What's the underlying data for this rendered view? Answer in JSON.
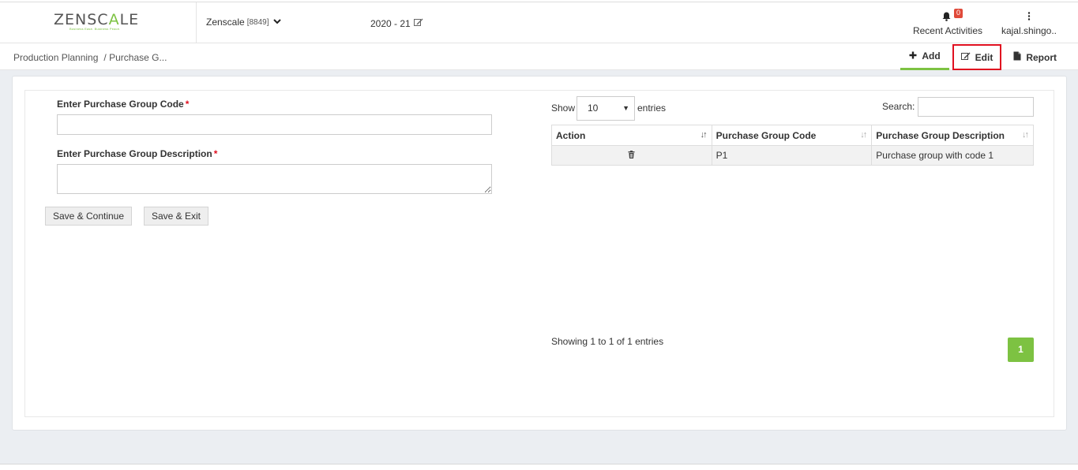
{
  "header": {
    "logo_prefix": "ZENSC",
    "logo_accent": "A",
    "logo_suffix": "LE",
    "logo_tagline": "Business Ease. Business Peace.",
    "company_name": "Zenscale",
    "company_code": "[8849]",
    "financial_year": "2020 - 21",
    "notification_count": "0",
    "notifications_label": "Recent Activities",
    "user_label": "kajal.shingo.."
  },
  "breadcrumb": {
    "root": "Production Planning",
    "current": "/ Purchase G..."
  },
  "toolbar": {
    "add_label": "Add",
    "edit_label": "Edit",
    "report_label": "Report"
  },
  "form": {
    "code_label": "Enter Purchase Group Code",
    "code_value": "",
    "description_label": "Enter Purchase Group Description",
    "description_value": "",
    "required_mark": "*",
    "save_continue_label": "Save & Continue",
    "save_exit_label": "Save & Exit"
  },
  "table": {
    "show_label": "Show",
    "page_size": "10",
    "entries_label": "entries",
    "search_label": "Search:",
    "search_value": "",
    "columns": [
      "Action",
      "Purchase Group Code",
      "Purchase Group Description"
    ],
    "rows": [
      {
        "code": "P1",
        "description": "Purchase group with code 1"
      }
    ],
    "info": "Showing 1 to 1 of 1 entries",
    "current_page": "1"
  },
  "colors": {
    "accent": "#7dc242",
    "highlight": "#e01020",
    "badge": "#e04a3a"
  }
}
